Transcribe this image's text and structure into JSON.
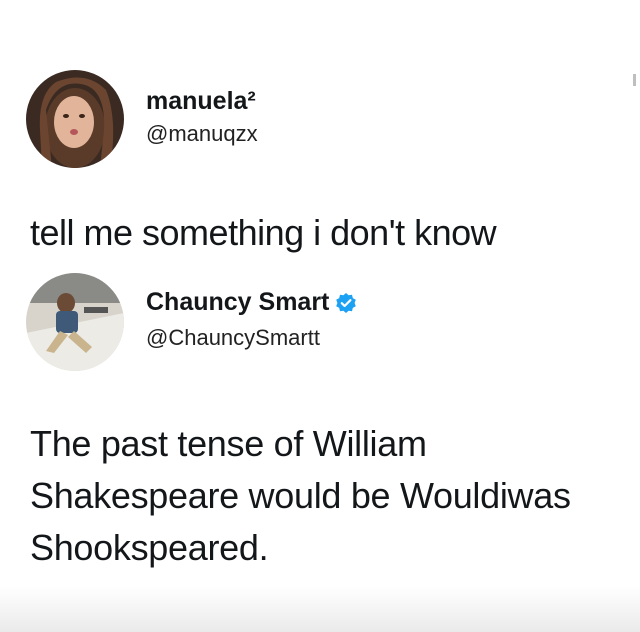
{
  "tweets": [
    {
      "display_name": "manuela²",
      "handle": "@manuqzx",
      "verified": false,
      "text": "tell me something i don't know"
    },
    {
      "display_name": "Chauncy Smart",
      "handle": "@ChauncySmartt",
      "verified": true,
      "text": "The past tense of William Shakespeare would be Wouldiwas Shookspeared."
    }
  ],
  "colors": {
    "text": "#14171a",
    "verified_badge": "#1da1f2",
    "background": "#ffffff"
  },
  "icons": {
    "verified": "verified-badge-icon"
  }
}
